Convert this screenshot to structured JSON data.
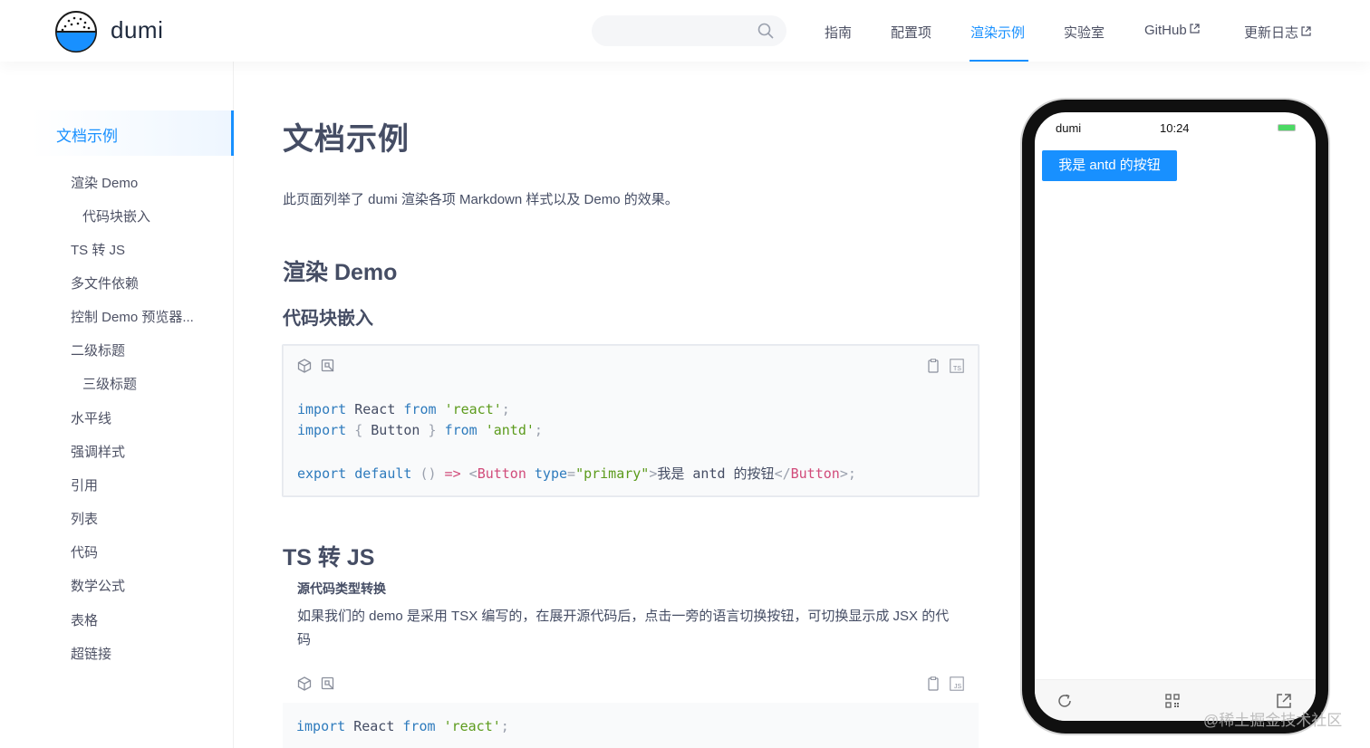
{
  "header": {
    "logo_text": "dumi",
    "search_placeholder": "",
    "nav": [
      {
        "label": "指南"
      },
      {
        "label": "配置项"
      },
      {
        "label": "渲染示例"
      },
      {
        "label": "实验室"
      },
      {
        "label": "GitHub"
      },
      {
        "label": "更新日志"
      }
    ]
  },
  "sidebar": {
    "active": "文档示例",
    "items": [
      {
        "label": "渲染 Demo"
      },
      {
        "label": "代码块嵌入"
      },
      {
        "label": "TS 转 JS"
      },
      {
        "label": "多文件依赖"
      },
      {
        "label": "控制 Demo 预览器..."
      },
      {
        "label": "二级标题"
      },
      {
        "label": "三级标题"
      },
      {
        "label": "水平线"
      },
      {
        "label": "强调样式"
      },
      {
        "label": "引用"
      },
      {
        "label": "列表"
      },
      {
        "label": "代码"
      },
      {
        "label": "数学公式"
      },
      {
        "label": "表格"
      },
      {
        "label": "超链接"
      }
    ]
  },
  "content": {
    "title": "文档示例",
    "intro": "此页面列举了 dumi 渲染各项 Markdown 样式以及 Demo 的效果。",
    "section1": "渲染 Demo",
    "subsection1": "代码块嵌入",
    "code1": {
      "line1": {
        "import": "import",
        "name": " React ",
        "from": "from",
        "str": "'react'",
        "semi": ";"
      },
      "line2": {
        "import": "import",
        "open": " { ",
        "name": "Button",
        "close": " } ",
        "from": "from",
        "str": "'antd'",
        "semi": ";"
      },
      "line3": {
        "export": "export",
        "default": " default ",
        "paren": "()",
        "arrow": " => ",
        "lt": "<",
        "tag": "Button",
        "attr": " type",
        "eq": "=",
        "str": "\"primary\"",
        "gt": ">",
        "text": "我是 antd 的按钮",
        "close_lt": "</",
        "close_tag": "Button",
        "close_gt": ">",
        "semi": ";"
      }
    },
    "section2": "TS 转 JS",
    "ts_title": "源代码类型转换",
    "ts_desc": "如果我们的 demo 是采用 TSX 编写的，在展开源代码后，点击一旁的语言切换按钮，可切换显示成 JSX 的代码",
    "code2": {
      "line1": {
        "import": "import",
        "name": " React ",
        "from": "from",
        "str": "'react'",
        "semi": ";"
      }
    },
    "ts_badge": "TS",
    "js_badge": "JS"
  },
  "phone": {
    "app_name": "dumi",
    "time": "10:24",
    "button_label": "我是 antd 的按钮"
  },
  "watermark": "@稀土掘金技术社区",
  "colors": {
    "accent": "#1890ff",
    "text": "#454d64",
    "keyword": "#2e7bbd",
    "string": "#5c9b1c",
    "tag": "#d14b7a"
  }
}
